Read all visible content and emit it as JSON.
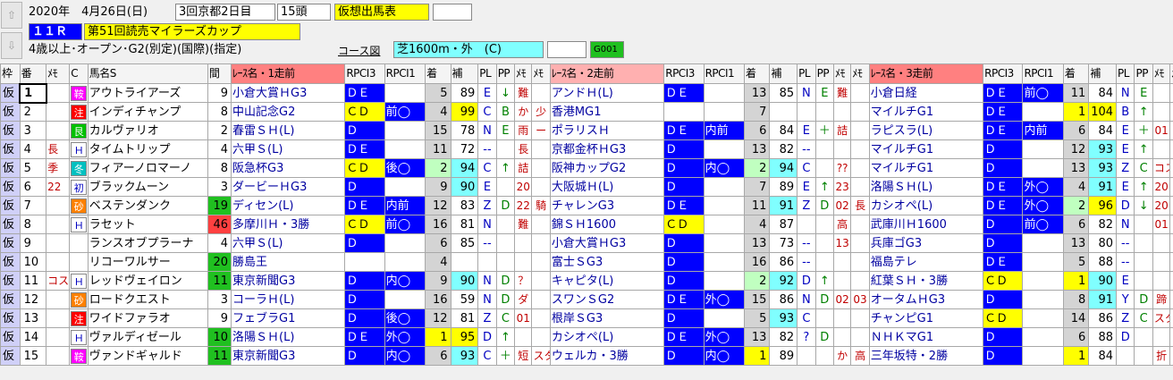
{
  "header": {
    "nav_up": "⇧",
    "nav_down": "⇩",
    "date": "2020年　4月26日(日)",
    "meeting": "3回京都2日目",
    "head_count": "15頭",
    "status": "仮想出馬表",
    "race_no": "１１Ｒ",
    "race_name": "第51回読売マイラーズカップ",
    "conditions": "4歳以上･オープン･G2(別定)(国際)(指定)",
    "course_link": "コース図",
    "course": "芝1600m・外　(C)",
    "code": "G001"
  },
  "colors": {
    "blue": "#0000ff",
    "yellow": "#ffff00",
    "cyan": "#80ffff",
    "pink": "#ffc0c0",
    "lightgreen": "#c0ffc0",
    "green": "#20c020",
    "red": "#ff4040",
    "kari": "#d0d0f8"
  },
  "columns": {
    "waku": "枠",
    "ban": "番",
    "memo": "ﾒﾓ",
    "c": "C",
    "name": "馬名S",
    "kan": "間",
    "r1": "ﾚｰｽ名・1走前",
    "rpci3": "RPCI3",
    "rpci1": "RPCI1",
    "chaku": "着",
    "ho": "補",
    "pl": "PL",
    "pp": "PP",
    "m1": "ﾒﾓ",
    "m2": "ﾒﾓ",
    "r2": "ﾚｰｽ名・2走前",
    "r3": "ﾚｰｽ名・3走前"
  },
  "rows": [
    {
      "waku": "仮",
      "ban": "1",
      "memo": "",
      "mark": "鞍",
      "mark_color": "#ff00ff",
      "name": "アウトライアーズ",
      "kan": "9",
      "kan_style": "",
      "r": [
        [
          "小倉大賞ＨG3",
          "ＤＥ",
          "",
          "5",
          "89",
          "E",
          "↓",
          "難",
          "",
          "#ffffff"
        ],
        [
          "アンドＨ(L)",
          "ＤＥ",
          "",
          "13",
          "85",
          "N",
          "E",
          "難",
          "",
          "#ffc0c0"
        ],
        [
          "小倉日経",
          "ＤＥ",
          "前◯",
          "11",
          "84",
          "N",
          "E",
          "",
          ""
        ]
      ]
    },
    {
      "waku": "仮",
      "ban": "2",
      "memo": "",
      "mark": "注",
      "mark_color": "#ff0000",
      "name": "インディチャンプ",
      "kan": "8",
      "kan_style": "",
      "r": [
        [
          "中山記念G2",
          "ＣＤ",
          "前◯",
          "4",
          "99",
          "C",
          "B",
          "か",
          "少"
        ],
        [
          "香港MG1",
          "",
          "",
          "7",
          "",
          "",
          "",
          "",
          ""
        ],
        [
          "マイルチG1",
          "ＤＥ",
          "",
          "1",
          "104",
          "B",
          "↑",
          "",
          ""
        ]
      ]
    },
    {
      "waku": "仮",
      "ban": "3",
      "memo": "",
      "mark": "艮",
      "mark_color": "#00c000",
      "name": "カルヴァリオ",
      "kan": "2",
      "kan_style": "",
      "r": [
        [
          "春雷ＳＨ(L)",
          "Ｄ",
          "",
          "15",
          "78",
          "N",
          "E",
          "雨",
          "ー"
        ],
        [
          "ポラリスＨ",
          "ＤＥ",
          "内前",
          "6",
          "84",
          "E",
          "＋",
          "詰",
          ""
        ],
        [
          "ラピスラ(L)",
          "ＤＥ",
          "内前",
          "6",
          "84",
          "E",
          "＋",
          "01",
          "△"
        ]
      ]
    },
    {
      "waku": "仮",
      "ban": "4",
      "memo": "長",
      "mark": "Ｈ",
      "mark_color": "#ffffff",
      "name": "タイムトリップ",
      "kan": "4",
      "kan_style": "",
      "r": [
        [
          "六甲Ｓ(L)",
          "ＤＥ",
          "",
          "11",
          "72",
          "--",
          "",
          "長",
          ""
        ],
        [
          "京都金杯ＨG3",
          "Ｄ",
          "",
          "13",
          "82",
          "--",
          "",
          "",
          ""
        ],
        [
          "マイルチG1",
          "Ｄ",
          "",
          "12",
          "93",
          "E",
          "↑",
          "",
          ""
        ]
      ]
    },
    {
      "waku": "仮",
      "ban": "5",
      "memo": "季",
      "mark": "冬",
      "mark_color": "#00c0c0",
      "name": "フィアーノロマーノ",
      "kan": "8",
      "kan_style": "",
      "r": [
        [
          "阪急杯G3",
          "ＣＤ",
          "後◯",
          "2",
          "94",
          "C",
          "↑",
          "詰",
          ""
        ],
        [
          "阪神カップG2",
          "Ｄ",
          "内◯",
          "2",
          "94",
          "C",
          "",
          "??",
          ""
        ],
        [
          "マイルチG1",
          "Ｄ",
          "",
          "13",
          "93",
          "Z",
          "C",
          "コス",
          "20"
        ]
      ]
    },
    {
      "waku": "仮",
      "ban": "6",
      "memo": "22",
      "mark": "初",
      "mark_color": "#ffffff",
      "name": "ブラックムーン",
      "kan": "3",
      "kan_style": "",
      "r": [
        [
          "ダービーＨG3",
          "Ｄ",
          "",
          "9",
          "90",
          "E",
          "",
          "20",
          ""
        ],
        [
          "大阪城Ｈ(L)",
          "Ｄ",
          "",
          "7",
          "89",
          "E",
          "↑",
          "23",
          ""
        ],
        [
          "洛陽ＳＨ(L)",
          "ＤＥ",
          "外◯",
          "4",
          "91",
          "E",
          "↑",
          "20",
          ""
        ]
      ]
    },
    {
      "waku": "仮",
      "ban": "7",
      "memo": "",
      "mark": "砂",
      "mark_color": "#ff8000",
      "name": "ベステンダンク",
      "kan": "19",
      "kan_style": "green",
      "r": [
        [
          "ディセン(L)",
          "ＤＥ",
          "内前",
          "12",
          "83",
          "Z",
          "D",
          "22",
          "騎"
        ],
        [
          "チャレンG3",
          "ＤＥ",
          "",
          "11",
          "91",
          "Z",
          "D",
          "02",
          "長"
        ],
        [
          "カシオペ(L)",
          "ＤＥ",
          "外◯",
          "2",
          "96",
          "D",
          "↓",
          "20",
          ""
        ]
      ]
    },
    {
      "waku": "仮",
      "ban": "8",
      "memo": "",
      "mark": "Ｈ",
      "mark_color": "#ffffff",
      "name": "ラセット",
      "kan": "46",
      "kan_style": "red",
      "r": [
        [
          "多摩川Ｈ・3勝",
          "ＣＤ",
          "前◯",
          "16",
          "81",
          "N",
          "",
          "難",
          ""
        ],
        [
          "錦ＳＨ1600",
          "ＣＤ",
          "",
          "4",
          "87",
          "",
          "",
          "高",
          ""
        ],
        [
          "武庫川Ｈ1600",
          "Ｄ",
          "前◯",
          "6",
          "82",
          "N",
          "",
          "01",
          ""
        ]
      ]
    },
    {
      "waku": "仮",
      "ban": "9",
      "memo": "",
      "mark": "",
      "mark_color": "",
      "name": "ランスオブプラーナ",
      "kan": "4",
      "kan_style": "",
      "r": [
        [
          "六甲Ｓ(L)",
          "Ｄ",
          "",
          "6",
          "85",
          "--",
          "",
          "",
          ""
        ],
        [
          "小倉大賞ＨG3",
          "Ｄ",
          "",
          "13",
          "73",
          "--",
          "",
          "13",
          ""
        ],
        [
          "兵庫ゴG3",
          "Ｄ",
          "",
          "13",
          "80",
          "--",
          "",
          "",
          ""
        ]
      ]
    },
    {
      "waku": "仮",
      "ban": "10",
      "memo": "",
      "mark": "",
      "mark_color": "",
      "name": "リコーワルサー",
      "kan": "20",
      "kan_style": "green",
      "r": [
        [
          "勝島王",
          "",
          "",
          "4",
          "",
          "",
          "",
          "",
          ""
        ],
        [
          "富士ＳG3",
          "Ｄ",
          "",
          "16",
          "86",
          "--",
          "",
          "",
          ""
        ],
        [
          "福島テレ",
          "ＤＥ",
          "",
          "5",
          "88",
          "--",
          "",
          "",
          ""
        ]
      ]
    },
    {
      "waku": "仮",
      "ban": "11",
      "memo": "コス",
      "mark": "Ｈ",
      "mark_color": "#ffffff",
      "name": "レッドヴェイロン",
      "kan": "11",
      "kan_style": "green",
      "r": [
        [
          "東京新聞G3",
          "Ｄ",
          "内◯",
          "9",
          "90",
          "N",
          "D",
          "？",
          ""
        ],
        [
          "キャピタ(L)",
          "Ｄ",
          "",
          "2",
          "92",
          "D",
          "↑",
          "",
          ""
        ],
        [
          "紅葉ＳＨ・3勝",
          "ＣＤ",
          "",
          "1",
          "90",
          "E",
          "",
          "",
          ""
        ]
      ]
    },
    {
      "waku": "仮",
      "ban": "12",
      "memo": "",
      "mark": "砂",
      "mark_color": "#ff8000",
      "name": "ロードクエスト",
      "kan": "3",
      "kan_style": "",
      "r": [
        [
          "コーラＨ(L)",
          "Ｄ",
          "",
          "16",
          "59",
          "N",
          "D",
          "ダ",
          ""
        ],
        [
          "スワンＳG2",
          "ＤＥ",
          "外◯",
          "15",
          "86",
          "N",
          "D",
          "02",
          "03"
        ],
        [
          "オータムＨG3",
          "Ｄ",
          "",
          "8",
          "91",
          "Y",
          "D",
          "蹄",
          "ア"
        ]
      ]
    },
    {
      "waku": "仮",
      "ban": "13",
      "memo": "",
      "mark": "注",
      "mark_color": "#ff0000",
      "name": "ワイドファラオ",
      "kan": "9",
      "kan_style": "",
      "r": [
        [
          "フェブラG1",
          "Ｄ",
          "後◯",
          "12",
          "81",
          "Z",
          "C",
          "01",
          ""
        ],
        [
          "根岸ＳG3",
          "Ｄ",
          "",
          "5",
          "93",
          "C",
          "",
          "",
          ""
        ],
        [
          "チャンピG1",
          "ＣＤ",
          "",
          "14",
          "86",
          "Z",
          "C",
          "スタ",
          "睛"
        ]
      ]
    },
    {
      "waku": "仮",
      "ban": "14",
      "memo": "",
      "mark": "Ｈ",
      "mark_color": "#ffffff",
      "name": "ヴァルディゼール",
      "kan": "10",
      "kan_style": "green",
      "r": [
        [
          "洛陽ＳＨ(L)",
          "ＤＥ",
          "外◯",
          "1",
          "95",
          "D",
          "↑",
          "",
          ""
        ],
        [
          "カシオペ(L)",
          "ＤＥ",
          "外◯",
          "13",
          "82",
          "?",
          "D",
          "",
          ""
        ],
        [
          "ＮＨＫマG1",
          "Ｄ",
          "",
          "6",
          "88",
          "D",
          "",
          "",
          ""
        ]
      ]
    },
    {
      "waku": "仮",
      "ban": "15",
      "memo": "",
      "mark": "鞍",
      "mark_color": "#ff00ff",
      "name": "ヴァンドギャルド",
      "kan": "11",
      "kan_style": "green",
      "r": [
        [
          "東京新聞G3",
          "Ｄ",
          "内◯",
          "6",
          "93",
          "C",
          "＋",
          "短",
          "スタ"
        ],
        [
          "ウェルカ・3勝",
          "Ｄ",
          "内◯",
          "1",
          "89",
          "",
          "",
          "か",
          "高"
        ],
        [
          "三年坂特・2勝",
          "Ｄ",
          "",
          "1",
          "84",
          "",
          "",
          "折",
          ""
        ]
      ]
    }
  ]
}
